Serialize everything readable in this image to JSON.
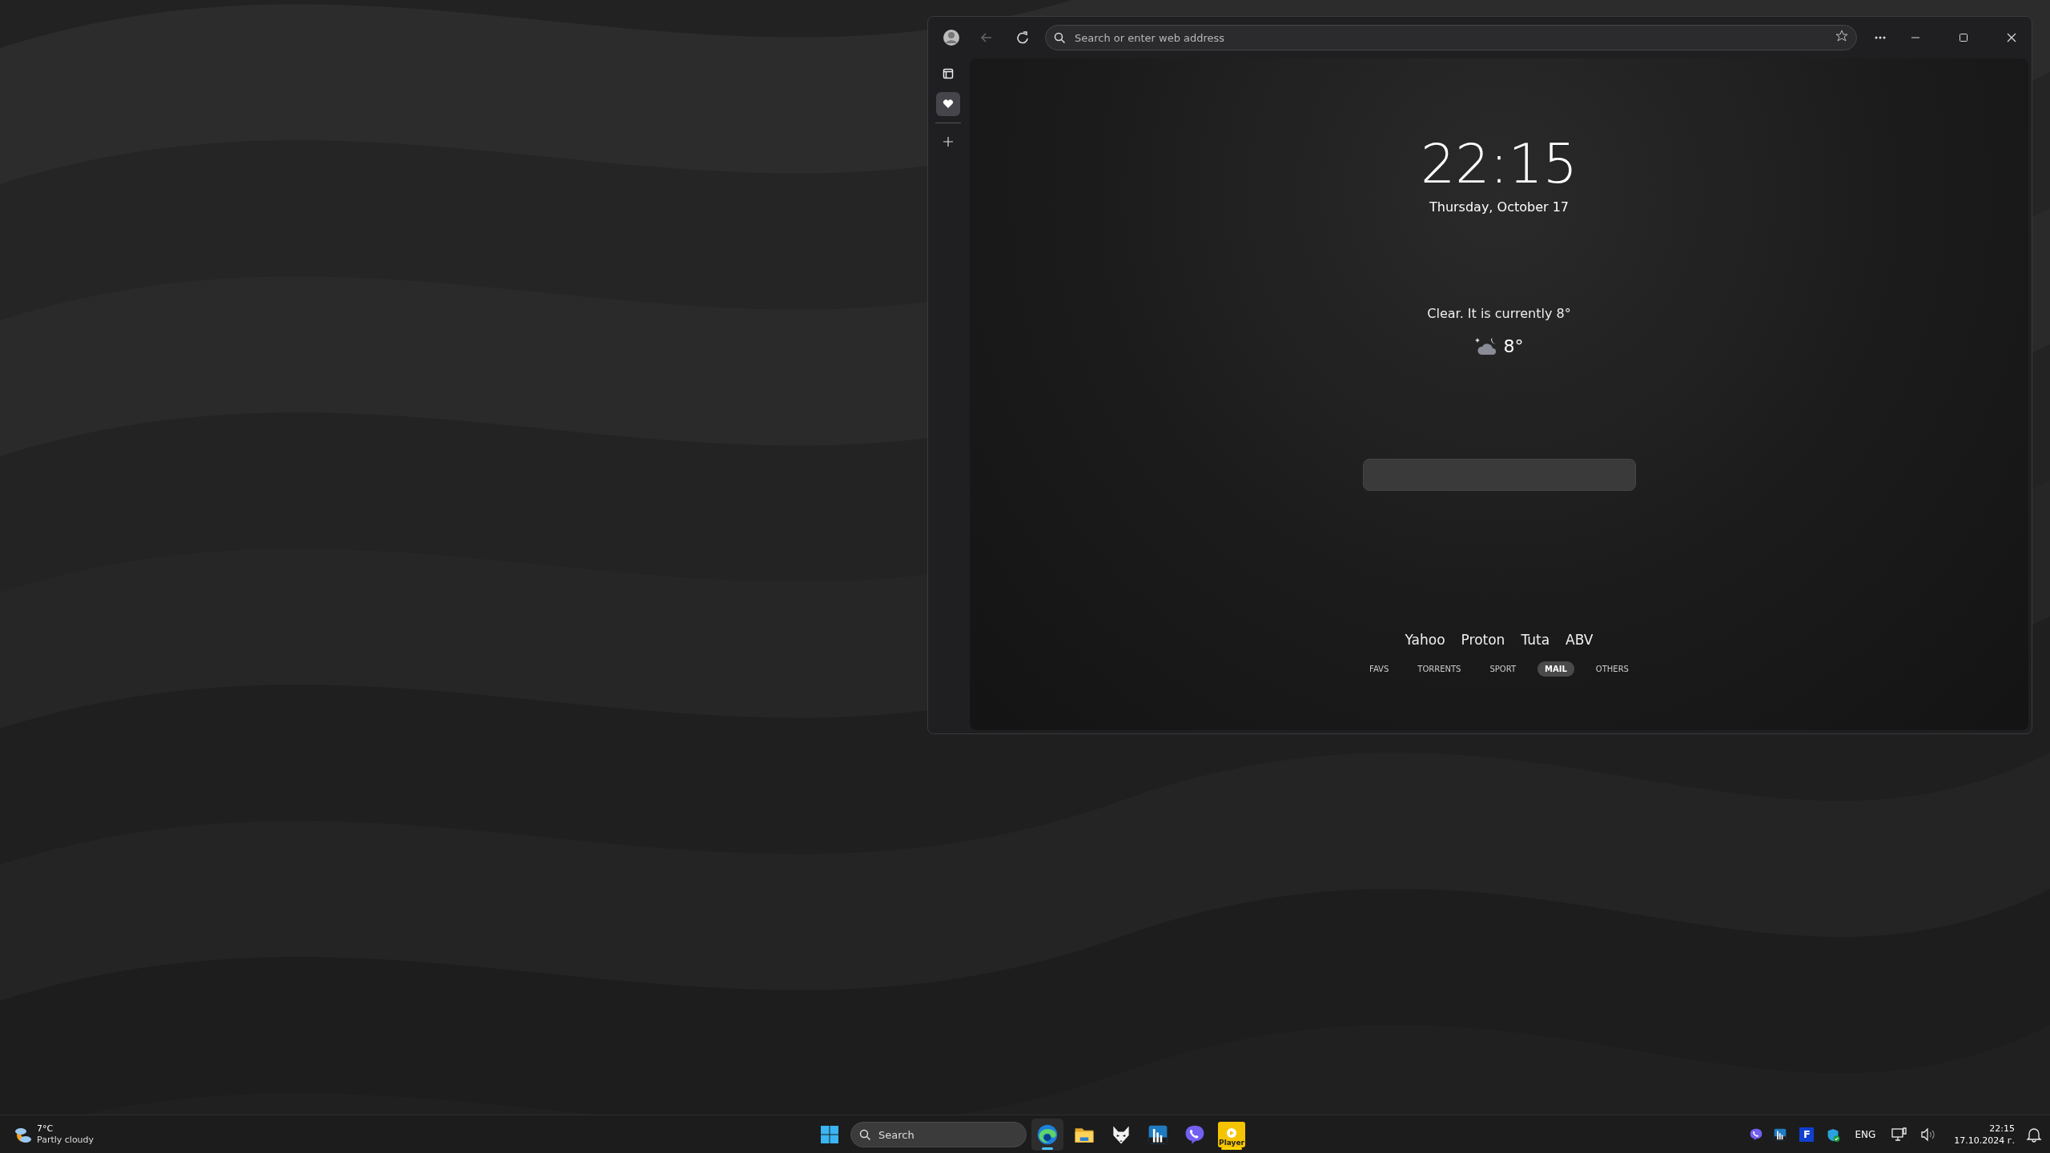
{
  "browser": {
    "back_disabled": true,
    "address_bar": {
      "placeholder": "Search or enter web address"
    },
    "sidebar": [
      {
        "kind": "tabs",
        "selected": false
      },
      {
        "kind": "favorites",
        "selected": true
      }
    ],
    "new_tab": {
      "clock": "22:15",
      "date": "Thursday, October 17",
      "weather_text": "Clear. It is currently 8°",
      "temperature": "8°",
      "links": [
        "Yahoo",
        "Proton",
        "Tuta",
        "ABV"
      ],
      "categories": [
        {
          "label": "FAVS",
          "selected": false
        },
        {
          "label": "TORRENTS",
          "selected": false
        },
        {
          "label": "SPORT",
          "selected": false
        },
        {
          "label": "MAIL",
          "selected": true
        },
        {
          "label": "OTHERS",
          "selected": false
        }
      ]
    }
  },
  "taskbar": {
    "weather": {
      "temperature": "7°C",
      "condition": "Partly cloudy"
    },
    "search": {
      "placeholder": "Search"
    },
    "apps": [
      {
        "kind": "edge",
        "focused": true,
        "running": true
      },
      {
        "kind": "folder",
        "focused": false,
        "running": false
      },
      {
        "kind": "fox",
        "focused": false,
        "running": false
      },
      {
        "kind": "bars",
        "focused": false,
        "running": false
      },
      {
        "kind": "phone",
        "focused": false,
        "running": false
      },
      {
        "kind": "player",
        "focused": false,
        "running": true,
        "label": "Player"
      }
    ],
    "tray": [
      {
        "kind": "phone"
      },
      {
        "kind": "bars"
      },
      {
        "kind": "letter",
        "label": "F"
      },
      {
        "kind": "shield"
      }
    ],
    "language": "ENG",
    "time": "22:15",
    "date": "17.10.2024 г."
  }
}
